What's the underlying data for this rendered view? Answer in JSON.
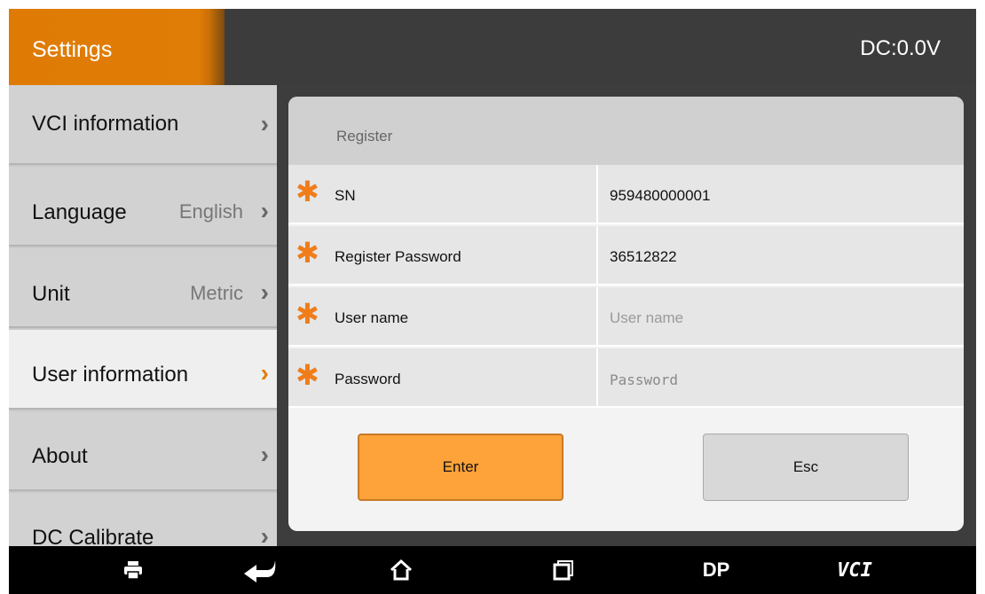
{
  "topbar": {
    "title": "Settings",
    "dc_readout": "DC:0.0V"
  },
  "sidebar": {
    "items": [
      {
        "label": "VCI information",
        "value": ""
      },
      {
        "label": "Language",
        "value": "English"
      },
      {
        "label": "Unit",
        "value": "Metric"
      },
      {
        "label": "User information",
        "value": ""
      },
      {
        "label": "About",
        "value": ""
      },
      {
        "label": "DC Calibrate",
        "value": ""
      }
    ],
    "active": "User information"
  },
  "dialog": {
    "title": "Register",
    "rows": [
      {
        "label": "SN",
        "value": "959480000001",
        "placeholder": ""
      },
      {
        "label": "Register Password",
        "value": "36512822",
        "placeholder": ""
      },
      {
        "label": "User name",
        "value": "",
        "placeholder": "User name"
      },
      {
        "label": "Password",
        "value": "",
        "placeholder": "Password"
      }
    ],
    "required_mark": "✱",
    "enter_label": "Enter",
    "esc_label": "Esc"
  },
  "navbar": {
    "items": [
      "printer-icon",
      "back-icon",
      "home-icon",
      "recent-apps-icon",
      "DP",
      "VCI"
    ],
    "dp_label": "DP",
    "vci_label": "VCI"
  },
  "colors": {
    "accent": "#e07d06",
    "enter_button": "#fea23a",
    "required": "#f07d1a"
  }
}
